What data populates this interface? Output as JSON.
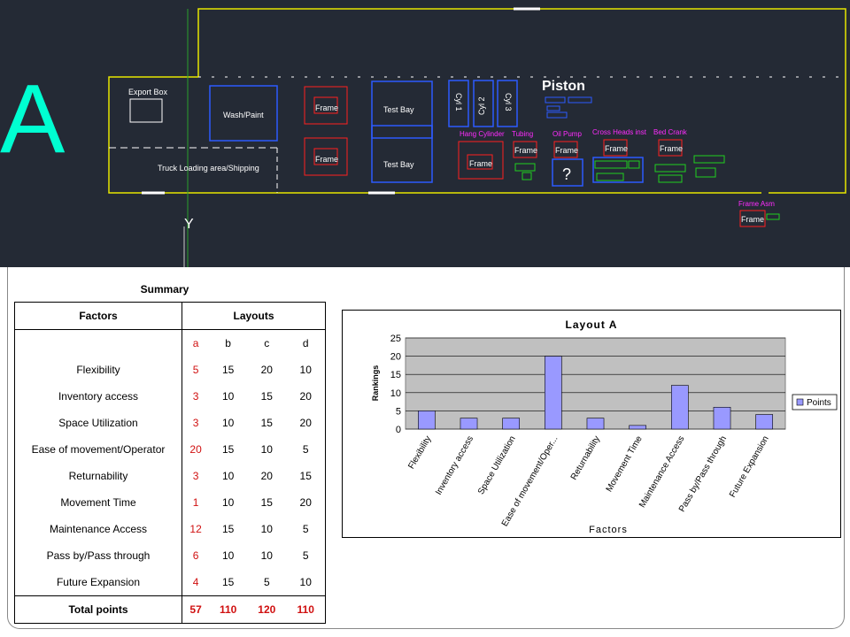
{
  "cad": {
    "letter": "A",
    "piston_label": "Piston",
    "labels": {
      "export_box": "Export Box",
      "wash_paint": "Wash/Paint",
      "frame": "Frame",
      "test_bay": "Test Bay",
      "cyl1": "Cyl 1",
      "cyl2": "Cyl 2",
      "cyl3": "Cyl 3",
      "truck": "Truck Loading area/Shipping",
      "hang_cylinder": "Hang Cylinder",
      "tubing": "Tubing",
      "oil_pump": "Oil Pump",
      "cross_heads": "Cross Heads inst",
      "bed_crank": "Bed Crank",
      "frame_asm": "Frame Asm",
      "question": "?"
    }
  },
  "summary": {
    "title": "Summary",
    "col_factors": "Factors",
    "col_layouts": "Layouts",
    "layout_letters": [
      "a",
      "b",
      "c",
      "d"
    ],
    "rows": [
      {
        "factor": "Flexibility",
        "a": "5",
        "b": "15",
        "c": "20",
        "d": "10"
      },
      {
        "factor": "Inventory access",
        "a": "3",
        "b": "10",
        "c": "15",
        "d": "20"
      },
      {
        "factor": "Space Utilization",
        "a": "3",
        "b": "10",
        "c": "15",
        "d": "20"
      },
      {
        "factor": "Ease of movement/Operator",
        "a": "20",
        "b": "15",
        "c": "10",
        "d": "5"
      },
      {
        "factor": "Returnability",
        "a": "3",
        "b": "10",
        "c": "20",
        "d": "15"
      },
      {
        "factor": "Movement Time",
        "a": "1",
        "b": "10",
        "c": "15",
        "d": "20"
      },
      {
        "factor": "Maintenance Access",
        "a": "12",
        "b": "15",
        "c": "10",
        "d": "5"
      },
      {
        "factor": "Pass by/Pass through",
        "a": "6",
        "b": "10",
        "c": "10",
        "d": "5"
      },
      {
        "factor": "Future Expansion",
        "a": "4",
        "b": "15",
        "c": "5",
        "d": "10"
      }
    ],
    "total": {
      "label": "Total points",
      "a": "57",
      "b": "110",
      "c": "120",
      "d": "110"
    }
  },
  "chart_data": {
    "type": "bar",
    "title": "Layout A",
    "xlabel": "Factors",
    "ylabel": "Rankings",
    "ylim": [
      0,
      25
    ],
    "yticks": [
      0,
      5,
      10,
      15,
      20,
      25
    ],
    "grid": true,
    "legend": "right",
    "categories": [
      "Flexibility",
      "Inventory access",
      "Space Utilization",
      "Ease of movement/Oper...",
      "Returnability",
      "Movement Time",
      "Maintenance Access",
      "Pass by/Pass through",
      "Future Expansion"
    ],
    "series": [
      {
        "name": "Points",
        "values": [
          5,
          3,
          3,
          20,
          3,
          1,
          12,
          6,
          4
        ],
        "color": "#9999ff"
      }
    ],
    "plot_bg": "#c0c0c0"
  }
}
